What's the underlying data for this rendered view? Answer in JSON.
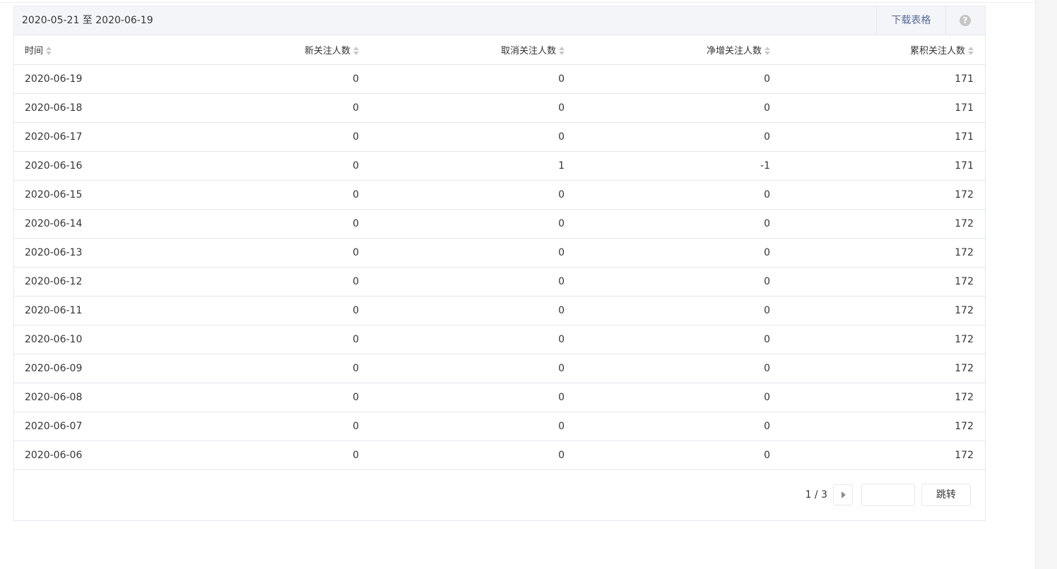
{
  "header": {
    "date_range": "2020-05-21 至 2020-06-19",
    "download_label": "下载表格",
    "help_glyph": "?"
  },
  "table": {
    "columns": [
      "时间",
      "新关注人数",
      "取消关注人数",
      "净增关注人数",
      "累积关注人数"
    ],
    "rows": [
      [
        "2020-06-19",
        "0",
        "0",
        "0",
        "171"
      ],
      [
        "2020-06-18",
        "0",
        "0",
        "0",
        "171"
      ],
      [
        "2020-06-17",
        "0",
        "0",
        "0",
        "171"
      ],
      [
        "2020-06-16",
        "0",
        "1",
        "-1",
        "171"
      ],
      [
        "2020-06-15",
        "0",
        "0",
        "0",
        "172"
      ],
      [
        "2020-06-14",
        "0",
        "0",
        "0",
        "172"
      ],
      [
        "2020-06-13",
        "0",
        "0",
        "0",
        "172"
      ],
      [
        "2020-06-12",
        "0",
        "0",
        "0",
        "172"
      ],
      [
        "2020-06-11",
        "0",
        "0",
        "0",
        "172"
      ],
      [
        "2020-06-10",
        "0",
        "0",
        "0",
        "172"
      ],
      [
        "2020-06-09",
        "0",
        "0",
        "0",
        "172"
      ],
      [
        "2020-06-08",
        "0",
        "0",
        "0",
        "172"
      ],
      [
        "2020-06-07",
        "0",
        "0",
        "0",
        "172"
      ],
      [
        "2020-06-06",
        "0",
        "0",
        "0",
        "172"
      ]
    ]
  },
  "pagination": {
    "page_label": "1 / 3",
    "jump_label": "跳转",
    "input_value": ""
  },
  "colors": {
    "link": "#576b95",
    "header_bg": "#f4f5f9",
    "border": "#e4e8eb"
  }
}
